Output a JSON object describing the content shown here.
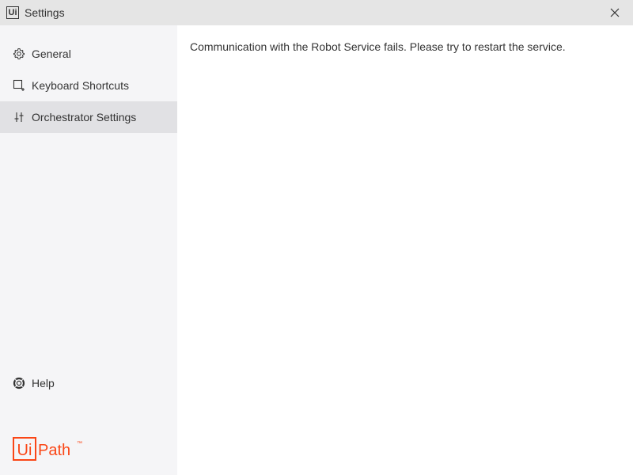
{
  "window": {
    "title": "Settings",
    "app_icon_text": "Ui",
    "app_icon_name": "uipath-app-icon",
    "close_icon": "close-icon"
  },
  "sidebar": {
    "items": [
      {
        "label": "General",
        "icon": "gear-icon",
        "active": false
      },
      {
        "label": "Keyboard Shortcuts",
        "icon": "keyboard-shortcut-icon",
        "active": false
      },
      {
        "label": "Orchestrator Settings",
        "icon": "sliders-icon",
        "active": true
      }
    ],
    "help": {
      "label": "Help",
      "icon": "lifebuoy-icon"
    },
    "logo": {
      "text_ui": "Ui",
      "text_path": "Path",
      "trademark": "™",
      "color": "#fa4616"
    }
  },
  "main": {
    "message": "Communication with the Robot Service fails. Please try to restart the service."
  },
  "colors": {
    "titlebar_bg": "#e5e5e5",
    "sidebar_bg": "#f5f5f7",
    "active_item_bg": "#e1e1e4",
    "text": "#333333",
    "brand": "#fa4616"
  }
}
